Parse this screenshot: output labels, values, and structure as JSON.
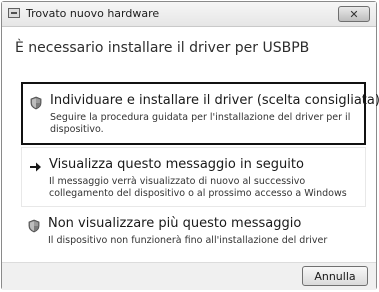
{
  "window": {
    "title": "Trovato nuovo hardware",
    "close_glyph": "✕"
  },
  "header": "È necessario installare il driver per USBPB",
  "options": [
    {
      "icon": "shield-icon",
      "title": "Individuare e installare il driver (scelta consigliata)",
      "description": "Seguire la procedura guidata per l'installazione del driver per il dispositivo."
    },
    {
      "icon": "arrow-right-icon",
      "title": "Visualizza questo messaggio in seguito",
      "description": "Il messaggio verrà visualizzato di nuovo al successivo collegamento del dispositivo o al prossimo accesso a Windows"
    },
    {
      "icon": "shield-icon",
      "title": "Non visualizzare più questo messaggio",
      "description": "Il dispositivo non funzionerà fino all'installazione del driver"
    }
  ],
  "footer": {
    "cancel_label": "Annulla"
  }
}
